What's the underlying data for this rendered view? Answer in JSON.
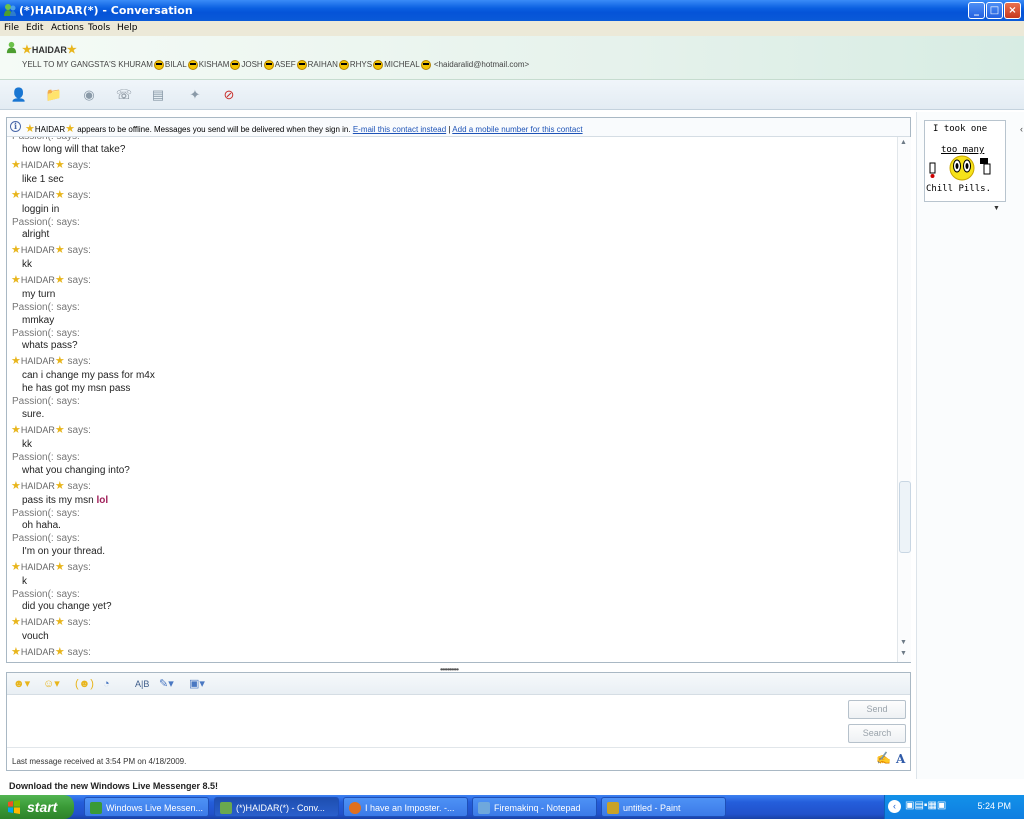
{
  "window": {
    "title": "(*)HAIDAR(*) - Conversation",
    "min_label": "_",
    "max_label": "□",
    "close_label": "×"
  },
  "menu": [
    "File",
    "Edit",
    "Actions",
    "Tools",
    "Help"
  ],
  "contact": {
    "name": "HAIDAR",
    "psm_prefix": "YELL TO MY GANGSTA'S KHURAM",
    "psm_names": [
      "BILAL",
      "KISHAM",
      "JOSH",
      "ASEF",
      "RAIHAN",
      "RHYS",
      "MICHEAL"
    ],
    "email": "<haidaralid@hotmail.com>"
  },
  "infobar": {
    "name": "HAIDAR",
    "text": "appears to be offline. Messages you send will be delivered when they sign in.",
    "link1": "E-mail this contact instead",
    "separator": "|",
    "link2": "Add a mobile number for this contact"
  },
  "messages": [
    {
      "type": "header",
      "sender": "Passion(:",
      "partial": true
    },
    {
      "type": "text",
      "text": "how long will that take?"
    },
    {
      "type": "header",
      "sender": "HAIDAR"
    },
    {
      "type": "text",
      "text": "like 1 sec"
    },
    {
      "type": "header",
      "sender": "HAIDAR"
    },
    {
      "type": "text",
      "text": "loggin in"
    },
    {
      "type": "header",
      "sender": "Passion(:"
    },
    {
      "type": "text",
      "text": "alright"
    },
    {
      "type": "header",
      "sender": "HAIDAR"
    },
    {
      "type": "text",
      "text": "kk"
    },
    {
      "type": "header",
      "sender": "HAIDAR"
    },
    {
      "type": "text",
      "text": "my turn"
    },
    {
      "type": "header",
      "sender": "Passion(:"
    },
    {
      "type": "text",
      "text": "mmkay"
    },
    {
      "type": "header",
      "sender": "Passion(:"
    },
    {
      "type": "text",
      "text": "whats pass?"
    },
    {
      "type": "header",
      "sender": "HAIDAR"
    },
    {
      "type": "text",
      "text": "can i change my pass for m4x"
    },
    {
      "type": "text",
      "text": " he has got my msn pass"
    },
    {
      "type": "header",
      "sender": "Passion(:"
    },
    {
      "type": "text",
      "text": "sure."
    },
    {
      "type": "header",
      "sender": "HAIDAR"
    },
    {
      "type": "text",
      "text": "kk"
    },
    {
      "type": "header",
      "sender": "Passion(:"
    },
    {
      "type": "text",
      "text": "what you changing into?"
    },
    {
      "type": "header",
      "sender": "HAIDAR"
    },
    {
      "type": "text",
      "text": "pass its my msn",
      "suffix": "lol"
    },
    {
      "type": "header",
      "sender": "Passion(:"
    },
    {
      "type": "text",
      "text": "oh haha."
    },
    {
      "type": "header",
      "sender": "Passion(:"
    },
    {
      "type": "text",
      "text": "I'm on your thread."
    },
    {
      "type": "header",
      "sender": "HAIDAR"
    },
    {
      "type": "text",
      "text": "k"
    },
    {
      "type": "header",
      "sender": "Passion(:"
    },
    {
      "type": "text",
      "text": "did you change yet?"
    },
    {
      "type": "header",
      "sender": "HAIDAR"
    },
    {
      "type": "text",
      "text": "vouch"
    },
    {
      "type": "header",
      "sender": "HAIDAR",
      "partial": true
    }
  ],
  "says_label": "says:",
  "input": {
    "send_label": "Send",
    "search_label": "Search",
    "status": "Last message received at 3:54 PM on 4/18/2009."
  },
  "display_picture": {
    "line1": "I took one",
    "line2": "too many",
    "line3": "Chill Pills."
  },
  "download_banner": "Download the new Windows Live Messenger 8.5!",
  "taskbar": {
    "start_label": "start",
    "tasks": [
      {
        "label": "Windows Live Messen...",
        "color": "#3a9a37"
      },
      {
        "label": "(*)HAIDAR(*) - Conv...",
        "color": "#6aa84f"
      },
      {
        "label": "I have an Imposter. -...",
        "color": "#e0701f"
      },
      {
        "label": "Firemakinq - Notepad",
        "color": "#6fa8dc"
      },
      {
        "label": "untitled - Paint",
        "color": "#c9a227"
      }
    ],
    "clock": "5:24 PM"
  },
  "colors": {
    "title_bar": "#0553d8",
    "link": "#1e53b7",
    "taskbar": "#245edb",
    "start": "#3a9a37"
  }
}
